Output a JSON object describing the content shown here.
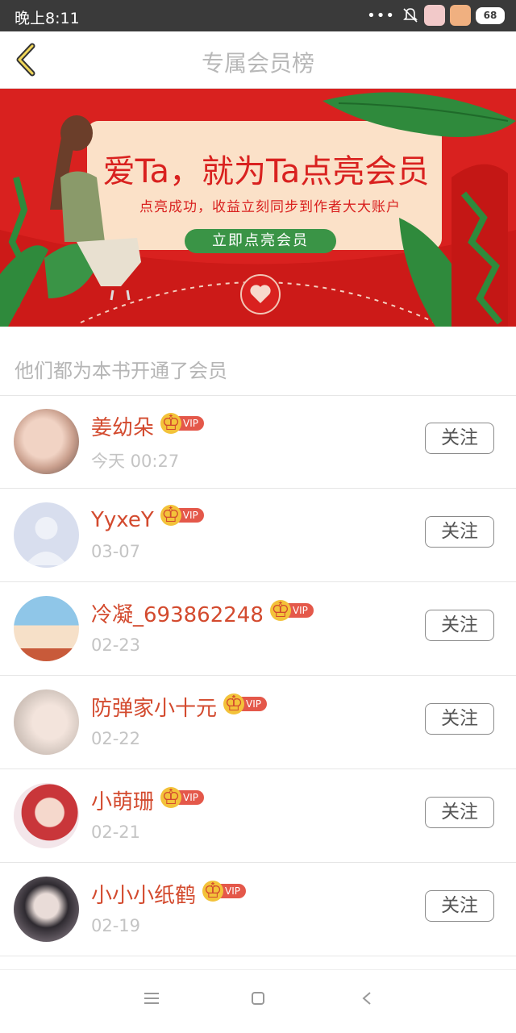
{
  "status_bar": {
    "time": "晚上8:11",
    "dots": "•••",
    "battery": "68"
  },
  "header": {
    "title": "专属会员榜"
  },
  "banner": {
    "title": "爱Ta，就为Ta点亮会员",
    "subtitle": "点亮成功，收益立刻同步到作者大大账户",
    "button": "立即点亮会员"
  },
  "section_label": "他们都为本书开通了会员",
  "vip_label": "VIP",
  "follow_label": "关注",
  "members": [
    {
      "name": "姜幼朵",
      "date": "今天 00:27"
    },
    {
      "name": "YyxeY",
      "date": "03-07"
    },
    {
      "name": "冷凝_693862248",
      "date": "02-23"
    },
    {
      "name": "防弹家小十元",
      "date": "02-22"
    },
    {
      "name": "小萌珊",
      "date": "02-21"
    },
    {
      "name": "小小小纸鹤",
      "date": "02-19"
    }
  ],
  "colors": {
    "accent_red": "#d9211f",
    "name_color": "#d34a2e",
    "banner_button": "#3a9446"
  }
}
